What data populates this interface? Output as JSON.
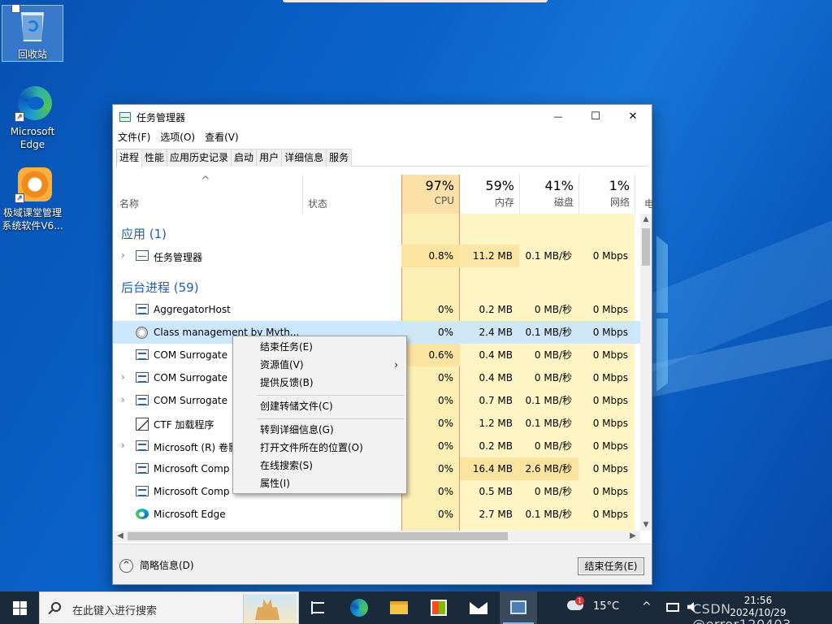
{
  "desktop": {
    "icons": [
      {
        "label": "回收站",
        "icon": "recycle-bin-icon"
      },
      {
        "label": "Microsoft Edge",
        "icon": "edge-icon"
      },
      {
        "label": "极域课堂管理系统软件V6...",
        "icon": "classroom-management-icon"
      }
    ]
  },
  "window": {
    "title": "任务管理器",
    "controls": {
      "minimize": "—",
      "maximize": "☐",
      "close": "✕"
    },
    "menu": [
      "文件(F)",
      "选项(O)",
      "查看(V)"
    ],
    "tabs": [
      "进程",
      "性能",
      "应用历史记录",
      "启动",
      "用户",
      "详细信息",
      "服务"
    ],
    "active_tab": "进程",
    "columns": {
      "sort_indicator": "^",
      "name": "名称",
      "status": "状态",
      "cpu": {
        "pct": "97%",
        "label": "CPU"
      },
      "memory": {
        "pct": "59%",
        "label": "内存"
      },
      "disk": {
        "pct": "41%",
        "label": "磁盘"
      },
      "network": {
        "pct": "1%",
        "label": "网络"
      },
      "power": "电"
    },
    "groups": {
      "apps": "应用 (1)",
      "background": "后台进程 (59)"
    },
    "processes": [
      {
        "name": "任务管理器",
        "expand": "›",
        "icon": "task-manager-icon",
        "cpu": "0.8%",
        "mem": "11.2 MB",
        "disk": "0.1 MB/秒",
        "net": "0 Mbps"
      },
      {
        "name": "AggregatorHost",
        "expand": "",
        "icon": "app-window-icon",
        "cpu": "0%",
        "mem": "0.2 MB",
        "disk": "0 MB/秒",
        "net": "0 Mbps"
      },
      {
        "name": "Class management by Myth...",
        "expand": "",
        "icon": "class-management-icon",
        "cpu": "0%",
        "mem": "2.4 MB",
        "disk": "0.1 MB/秒",
        "net": "0 Mbps"
      },
      {
        "name": "COM Surrogate",
        "expand": "",
        "icon": "app-window-icon",
        "cpu": "0.6%",
        "mem": "0.4 MB",
        "disk": "0 MB/秒",
        "net": "0 Mbps"
      },
      {
        "name": "COM Surrogate",
        "expand": "›",
        "icon": "app-window-icon",
        "cpu": "0%",
        "mem": "0.4 MB",
        "disk": "0 MB/秒",
        "net": "0 Mbps"
      },
      {
        "name": "COM Surrogate",
        "expand": "›",
        "icon": "app-window-icon",
        "cpu": "0%",
        "mem": "0.7 MB",
        "disk": "0.1 MB/秒",
        "net": "0 Mbps"
      },
      {
        "name": "CTF 加载程序",
        "expand": "",
        "icon": "ctf-loader-icon",
        "cpu": "0%",
        "mem": "1.2 MB",
        "disk": "0.1 MB/秒",
        "net": "0 Mbps"
      },
      {
        "name": "Microsoft (R) 卷影",
        "expand": "›",
        "icon": "app-window-icon",
        "cpu": "0%",
        "mem": "0.2 MB",
        "disk": "0 MB/秒",
        "net": "0 Mbps"
      },
      {
        "name": "Microsoft Comp",
        "expand": "",
        "icon": "app-window-icon",
        "cpu": "0%",
        "mem": "16.4 MB",
        "disk": "2.6 MB/秒",
        "net": "0 Mbps"
      },
      {
        "name": "Microsoft Comp",
        "expand": "",
        "icon": "app-window-icon",
        "cpu": "0%",
        "mem": "0.5 MB",
        "disk": "0 MB/秒",
        "net": "0 Mbps"
      },
      {
        "name": "Microsoft Edge",
        "expand": "",
        "icon": "edge-icon",
        "cpu": "0%",
        "mem": "2.7 MB",
        "disk": "0.1 MB/秒",
        "net": "0 Mbps"
      }
    ],
    "footer": {
      "brief_label": "简略信息(D)",
      "brief_icon": "^",
      "end_task": "结束任务(E)"
    }
  },
  "context_menu": {
    "items": [
      {
        "label": "结束任务(E)"
      },
      {
        "label": "资源值(V)",
        "submenu": "›"
      },
      {
        "label": "提供反馈(B)"
      },
      {
        "label": "创建转储文件(C)"
      },
      {
        "label": "转到详细信息(G)"
      },
      {
        "label": "打开文件所在的位置(O)"
      },
      {
        "label": "在线搜索(S)"
      },
      {
        "label": "属性(I)"
      }
    ]
  },
  "taskbar": {
    "search_placeholder": "在此键入进行搜索",
    "pinned": [
      "task-view-icon",
      "edge-icon",
      "file-explorer-icon",
      "store-icon",
      "mail-icon",
      "task-manager-icon"
    ],
    "weather": {
      "temp": "15°C",
      "badge": "1"
    },
    "tray_chevron": "^",
    "time": "21:56",
    "date": "2024/10/29"
  },
  "watermark": "CSDN @error120403",
  "colors": {
    "accent": "#0078d7",
    "cpu_heat": "#fcefb4",
    "cpu_heat_strong": "#fbe3a0",
    "cpu_border": "#e5926a",
    "selection": "#cce8ff"
  }
}
